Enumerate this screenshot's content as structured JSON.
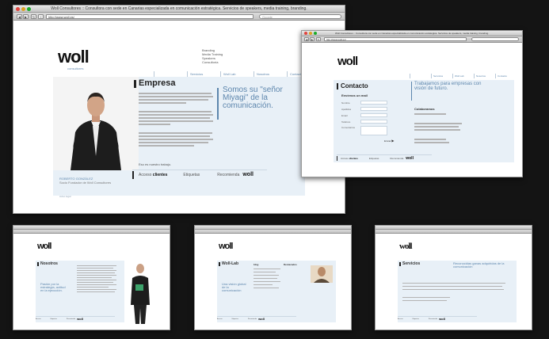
{
  "main_window": {
    "title": "Woll Consultores :: Consultora con sede en Canarias especializada en comunicación estratégica. Servicios de speakers, media training, branding.",
    "url": "http://www.woll.es/",
    "search_placeholder": "Google",
    "logo": "woll",
    "logo_sub": "consultores",
    "menu_lines": [
      "Branding",
      "Media Training",
      "Speakers",
      "Consultoría"
    ],
    "tabs": [
      "",
      "Servicios",
      "Woll Lab",
      "Nosotros",
      "Contacto"
    ],
    "heading": "Empresa",
    "slogan": "Somos su \"señor Miyagi\" de la comunicación.",
    "caption_name": "ROBERTO GONZÁLEZ",
    "caption_role": "Socio Fundador de Woll Consultores",
    "end_link": "Eso es nuestro trabajo.",
    "footer": {
      "access_prefix": "Acceso",
      "access_bold": "clientes",
      "tags": "Etiquetas",
      "recommend": "Recomienda"
    },
    "bottom_text": "Aviso legal"
  },
  "contact_window": {
    "title": "Woll Consultores :: Consultora con sede en Canarias especializada en comunicación estratégica. Servicios de speakers, media training, branding.",
    "url": "http://www.woll.es/",
    "logo": "woll",
    "tabs": [
      "",
      "Servicios",
      "Woll Lab",
      "Nosotros",
      "Contacto"
    ],
    "heading": "Contacto",
    "slogan": "Trabajamos para empresas con visión de futuro.",
    "form_title": "Envíenos un mail",
    "fields": [
      "Nombre",
      "Apellidos",
      "Email",
      "Teléfono",
      "Comentarios"
    ],
    "send": "Enviar",
    "collab_title": "Colaboramos",
    "footer": {
      "access_prefix": "Acceso",
      "access_bold": "clientes",
      "tags": "Etiquetas",
      "recommend": "Recomienda"
    }
  },
  "thumbs": [
    {
      "logo": "woll",
      "heading": "Nosotros",
      "slogan": "Pasión por la estrategia, actitud en la ejecución."
    },
    {
      "logo": "woll",
      "heading": "Woll-Lab",
      "col1": "blog",
      "col2": "Destacados",
      "slogan": "Una visión global de la comunicación"
    },
    {
      "logo": "woll",
      "heading": "Servicios",
      "slogan": "Reconocidas ganas adquiridas de la comunicación"
    }
  ],
  "colors": {
    "accent": "#5d86ad",
    "band": "#e8f0f7",
    "background": "#141414"
  }
}
